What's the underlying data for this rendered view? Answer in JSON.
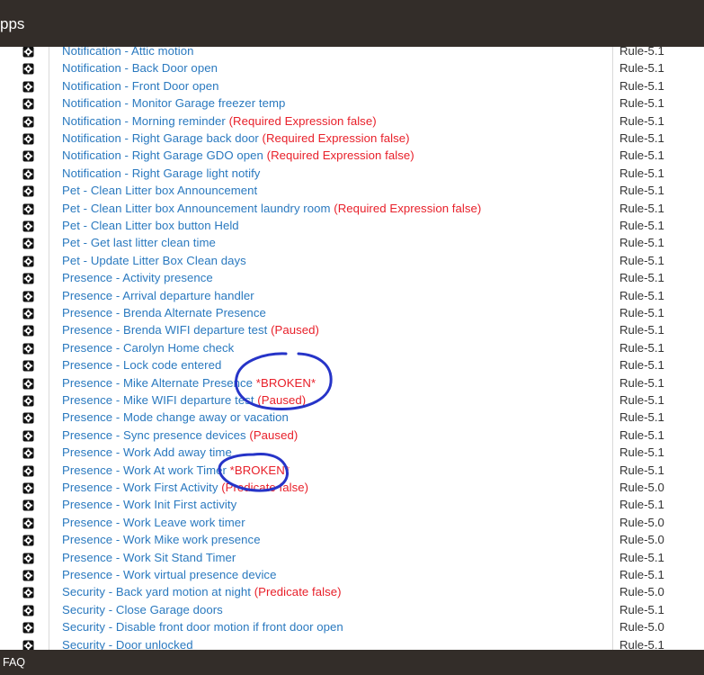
{
  "header": {
    "title": "pps"
  },
  "rows": [
    {
      "name": "Notification - Attic motion",
      "note": "",
      "version": "Rule-5.1"
    },
    {
      "name": "Notification - Back Door open",
      "note": "",
      "version": "Rule-5.1"
    },
    {
      "name": "Notification - Front Door open",
      "note": "",
      "version": "Rule-5.1"
    },
    {
      "name": "Notification - Monitor Garage freezer temp",
      "note": "",
      "version": "Rule-5.1"
    },
    {
      "name": "Notification - Morning reminder",
      "note": "(Required Expression false)",
      "version": "Rule-5.1"
    },
    {
      "name": "Notification - Right Garage back door",
      "note": "(Required Expression false)",
      "version": "Rule-5.1"
    },
    {
      "name": "Notification - Right Garage GDO open",
      "note": "(Required Expression false)",
      "version": "Rule-5.1"
    },
    {
      "name": "Notification - Right Garage light notify",
      "note": "",
      "version": "Rule-5.1"
    },
    {
      "name": "Pet - Clean Litter box Announcement",
      "note": "",
      "version": "Rule-5.1"
    },
    {
      "name": "Pet - Clean Litter box Announcement laundry room",
      "note": "(Required Expression false)",
      "version": "Rule-5.1"
    },
    {
      "name": "Pet - Clean Litter box button Held",
      "note": "",
      "version": "Rule-5.1"
    },
    {
      "name": "Pet - Get last litter clean time",
      "note": "",
      "version": "Rule-5.1"
    },
    {
      "name": "Pet - Update Litter Box Clean days",
      "note": "",
      "version": "Rule-5.1"
    },
    {
      "name": "Presence - Activity presence",
      "note": "",
      "version": "Rule-5.1"
    },
    {
      "name": "Presence - Arrival departure handler",
      "note": "",
      "version": "Rule-5.1"
    },
    {
      "name": "Presence - Brenda Alternate Presence",
      "note": "",
      "version": "Rule-5.1"
    },
    {
      "name": "Presence - Brenda WIFI departure test",
      "note": "(Paused)",
      "version": "Rule-5.1"
    },
    {
      "name": "Presence - Carolyn Home check",
      "note": "",
      "version": "Rule-5.1"
    },
    {
      "name": "Presence - Lock code entered",
      "note": "",
      "version": "Rule-5.1"
    },
    {
      "name": "Presence - Mike Alternate Presence",
      "note": "*BROKEN*",
      "version": "Rule-5.1"
    },
    {
      "name": "Presence - Mike WIFI departure test",
      "note": "(Paused)",
      "version": "Rule-5.1"
    },
    {
      "name": "Presence - Mode change away or vacation",
      "note": "",
      "version": "Rule-5.1"
    },
    {
      "name": "Presence - Sync presence devices",
      "note": "(Paused)",
      "version": "Rule-5.1"
    },
    {
      "name": "Presence - Work Add away time",
      "note": "",
      "version": "Rule-5.1"
    },
    {
      "name": "Presence - Work At work Timer",
      "note": "*BROKEN*",
      "version": "Rule-5.1"
    },
    {
      "name": "Presence - Work First Activity",
      "note": "(Predicate false)",
      "version": "Rule-5.0"
    },
    {
      "name": "Presence - Work Init First activity",
      "note": "",
      "version": "Rule-5.1"
    },
    {
      "name": "Presence - Work Leave work timer",
      "note": "",
      "version": "Rule-5.0"
    },
    {
      "name": "Presence - Work Mike work presence",
      "note": "",
      "version": "Rule-5.0"
    },
    {
      "name": "Presence - Work Sit Stand Timer",
      "note": "",
      "version": "Rule-5.1"
    },
    {
      "name": "Presence - Work virtual presence device",
      "note": "",
      "version": "Rule-5.1"
    },
    {
      "name": "Security - Back yard motion at night",
      "note": "(Predicate false)",
      "version": "Rule-5.0"
    },
    {
      "name": "Security - Close Garage doors",
      "note": "",
      "version": "Rule-5.1"
    },
    {
      "name": "Security - Disable front door motion if front door open",
      "note": "",
      "version": "Rule-5.0"
    },
    {
      "name": "Security - Door unlocked",
      "note": "",
      "version": "Rule-5.1"
    }
  ],
  "footer": {
    "faq": "FAQ"
  },
  "colors": {
    "bar": "#332d29",
    "link": "#2a79bf",
    "warn": "#e8202a",
    "annotation": "#2634c8"
  }
}
